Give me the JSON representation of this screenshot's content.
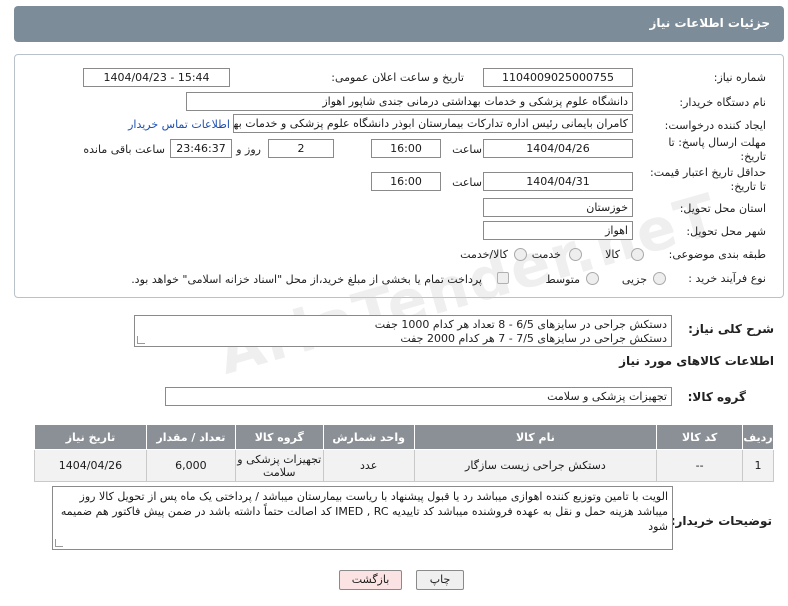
{
  "panel_title": "جزئیات اطلاعات نیاز",
  "fields": {
    "need_number_label": "شماره نیاز:",
    "need_number": "1104009025000755",
    "announce_label": "تاریخ و ساعت اعلان عمومی:",
    "announce_value": "1404/04/23 - 15:44",
    "buyer_org_label": "نام دستگاه خریدار:",
    "buyer_org": "دانشگاه علوم پزشکی و خدمات بهداشتی درمانی جندی شاپور اهواز",
    "creator_label": "ایجاد کننده درخواست:",
    "creator": "کامران بایمانی رئیس اداره تدارکات بیمارستان ابوذر  دانشگاه علوم پزشکی و خدمات بهد",
    "contact_link": "اطلاعات تماس خریدار",
    "reply_deadline_label": "مهلت ارسال پاسخ: تا تاریخ:",
    "reply_date": "1404/04/26",
    "time_label": "ساعت",
    "reply_time": "16:00",
    "days_value": "2",
    "days_label": "روز و",
    "remaining_time": "23:46:37",
    "remaining_label": "ساعت باقی مانده",
    "price_validity_label": "حداقل تاریخ اعتبار قیمت: تا تاریخ:",
    "validity_date": "1404/04/31",
    "validity_time": "16:00",
    "province_label": "استان محل تحویل:",
    "province": "خوزستان",
    "city_label": "شهر محل تحویل:",
    "city": "اهواز",
    "category_label": "طبقه بندی موضوعی:",
    "category_options": [
      "کالا",
      "خدمت",
      "کالا/خدمت"
    ],
    "process_label": "نوع فرآیند خرید :",
    "process_options": [
      "جزیی",
      "متوسط"
    ],
    "payment_note": "پرداخت تمام یا بخشی از مبلغ خرید،از محل \"اسناد خزانه اسلامی\" خواهد بود."
  },
  "description": {
    "label": "شرح کلی نیاز:",
    "line1": "دستکش جراحی در سایزهای 6/5  -  8  تعداد هر کدام 1000 جفت",
    "line2": "دستکش جراحی در سایزهای 7/5 -  7  هر کدام 2000 جفت"
  },
  "goods_info_title": "اطلاعات کالاهای مورد نیاز",
  "goods_group_label": "گروه کالا:",
  "goods_group": "تجهیزات پزشکی و سلامت",
  "table": {
    "headers": [
      "ردیف",
      "کد کالا",
      "نام کالا",
      "واحد شمارش",
      "گروه کالا",
      "تعداد / مقدار",
      "تاریخ نیاز"
    ],
    "rows": [
      [
        "1",
        "--",
        "دستکش جراحی زیست سازگار",
        "عدد",
        "تجهیزات پزشکی و سلامت",
        "6,000",
        "1404/04/26"
      ]
    ]
  },
  "buyer_notes": {
    "label": "توضیحات خریدار:",
    "text": "الویت با تامین وتوزیع کننده اهوازی میباشد رد یا قبول پیشنهاد با ریاست بیمارستان میباشد / پرداختی یک ماه پس از تحویل کالا روز  میباشد  هزینه حمل و نقل به عهده فروشنده میباشد کد تاییدیه IMED , RC کد اصالت حتماً داشته باشد در ضمن پیش فاکتور هم ضمیمه شود"
  },
  "buttons": {
    "print": "چاپ",
    "back": "بازگشت"
  },
  "watermark": "AriaTender.neT"
}
